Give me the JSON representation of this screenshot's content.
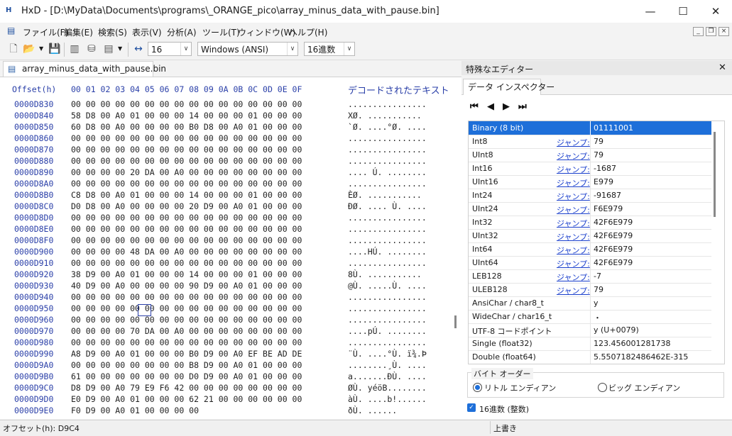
{
  "window": {
    "title": "HxD - [D:\\MyData\\Documents\\programs\\_ORANGE_pico\\array_minus_data_with_pause.bin]",
    "minimize": "—",
    "maximize": "☐",
    "close": "✕"
  },
  "menu": [
    "ファイル(F)",
    "編集(E)",
    "検索(S)",
    "表示(V)",
    "分析(A)",
    "ツール(T)",
    "ウィンドウ(W)",
    "ヘルプ(H)"
  ],
  "toolbar": {
    "bytes_per_row": "16",
    "charset": "Windows (ANSI)",
    "offset_base": "16進数"
  },
  "document_tab": "array_minus_data_with_pause.bin",
  "hex": {
    "offset_header": "Offset(h)",
    "column_header": "00 01 02 03 04 05 06 07 08 09 0A 0B 0C 0D 0E 0F",
    "decoded_header": "デコードされたテキスト",
    "rows": [
      {
        "offset": "0000D830",
        "bytes": "00 00 00 00 00 00 00 00 00 00 00 00 00 00 00 00",
        "text": "................"
      },
      {
        "offset": "0000D840",
        "bytes": "58 D8 00 A0 01 00 00 00 14 00 00 00 01 00 00 00",
        "text": "XØ. ..........."
      },
      {
        "offset": "0000D850",
        "bytes": "60 D8 00 A0 00 00 00 00 B0 D8 00 A0 01 00 00 00",
        "text": "`Ø. ....°Ø. ...."
      },
      {
        "offset": "0000D860",
        "bytes": "00 00 00 00 00 00 00 00 00 00 00 00 00 00 00 00",
        "text": "................"
      },
      {
        "offset": "0000D870",
        "bytes": "00 00 00 00 00 00 00 00 00 00 00 00 00 00 00 00",
        "text": "................"
      },
      {
        "offset": "0000D880",
        "bytes": "00 00 00 00 00 00 00 00 00 00 00 00 00 00 00 00",
        "text": "................"
      },
      {
        "offset": "0000D890",
        "bytes": "00 00 00 00 20 DA 00 A0 00 00 00 00 00 00 00 00",
        "text": ".... Ú. ........"
      },
      {
        "offset": "0000D8A0",
        "bytes": "00 00 00 00 00 00 00 00 00 00 00 00 00 00 00 00",
        "text": "................"
      },
      {
        "offset": "0000D8B0",
        "bytes": "C8 D8 00 A0 01 00 00 00 14 00 00 00 01 00 00 00",
        "text": "ÈØ. ..........."
      },
      {
        "offset": "0000D8C0",
        "bytes": "D0 D8 00 A0 00 00 00 00 20 D9 00 A0 01 00 00 00",
        "text": "ÐØ. .... Ù. ...."
      },
      {
        "offset": "0000D8D0",
        "bytes": "00 00 00 00 00 00 00 00 00 00 00 00 00 00 00 00",
        "text": "................"
      },
      {
        "offset": "0000D8E0",
        "bytes": "00 00 00 00 00 00 00 00 00 00 00 00 00 00 00 00",
        "text": "................"
      },
      {
        "offset": "0000D8F0",
        "bytes": "00 00 00 00 00 00 00 00 00 00 00 00 00 00 00 00",
        "text": "................"
      },
      {
        "offset": "0000D900",
        "bytes": "00 00 00 00 48 DA 00 A0 00 00 00 00 00 00 00 00",
        "text": "....HÚ. ........"
      },
      {
        "offset": "0000D910",
        "bytes": "00 00 00 00 00 00 00 00 00 00 00 00 00 00 00 00",
        "text": "................"
      },
      {
        "offset": "0000D920",
        "bytes": "38 D9 00 A0 01 00 00 00 14 00 00 00 01 00 00 00",
        "text": "8Ù. ..........."
      },
      {
        "offset": "0000D930",
        "bytes": "40 D9 00 A0 00 00 00 00 90 D9 00 A0 01 00 00 00",
        "text": "@Ù. .....Ù. ...."
      },
      {
        "offset": "0000D940",
        "bytes": "00 00 00 00 00 00 00 00 00 00 00 00 00 00 00 00",
        "text": "................"
      },
      {
        "offset": "0000D950",
        "bytes": "00 00 00 00 00 00 00 00 00 00 00 00 00 00 00 00",
        "text": "................"
      },
      {
        "offset": "0000D960",
        "bytes": "00 00 00 00 00 00 00 00 00 00 00 00 00 00 00 00",
        "text": "................"
      },
      {
        "offset": "0000D970",
        "bytes": "00 00 00 00 70 DA 00 A0 00 00 00 00 00 00 00 00",
        "text": "....pÚ. ........"
      },
      {
        "offset": "0000D980",
        "bytes": "00 00 00 00 00 00 00 00 00 00 00 00 00 00 00 00",
        "text": "................"
      },
      {
        "offset": "0000D990",
        "bytes": "A8 D9 00 A0 01 00 00 00 B0 D9 00 A0 EF BE AD DE",
        "text": "¨Ù. ....°Ù. ï¾.Þ"
      },
      {
        "offset": "0000D9A0",
        "bytes": "00 00 00 00 00 00 00 00 B8 D9 00 A0 01 00 00 00",
        "text": "........¸Ù. ...."
      },
      {
        "offset": "0000D9B0",
        "bytes": "61 00 00 00 00 00 00 00 D0 D9 00 A0 01 00 00 00",
        "text": "a.......ÐÙ. ...."
      },
      {
        "offset": "0000D9C0",
        "bytes": "D8 D9 00 A0 79 E9 F6 42 00 00 00 00 00 00 00 00",
        "text": "ØÙ. yéöB........"
      },
      {
        "offset": "0000D9D0",
        "bytes": "E0 D9 00 A0 01 00 00 00 62 21 00 00 00 00 00 00",
        "text": "àÙ. ....b!......"
      },
      {
        "offset": "0000D9E0",
        "bytes": "F0 D9 00 A0 01 00 00 00 00",
        "text": "ðÙ. ......"
      }
    ]
  },
  "special_editor": {
    "title": "特殊なエディター",
    "close": "✕",
    "tab": "データ インスペクター",
    "nav": [
      "⏮",
      "◀",
      "▶",
      "⏭"
    ],
    "rows": [
      {
        "name": "Binary (8 bit)",
        "jump": "",
        "value": "01111001"
      },
      {
        "name": "Int8",
        "jump": "ジャンプ:",
        "value": "79"
      },
      {
        "name": "UInt8",
        "jump": "ジャンプ:",
        "value": "79"
      },
      {
        "name": "Int16",
        "jump": "ジャンプ:",
        "value": "-1687"
      },
      {
        "name": "UInt16",
        "jump": "ジャンプ:",
        "value": "E979"
      },
      {
        "name": "Int24",
        "jump": "ジャンプ:",
        "value": "-91687"
      },
      {
        "name": "UInt24",
        "jump": "ジャンプ:",
        "value": "F6E979"
      },
      {
        "name": "Int32",
        "jump": "ジャンプ:",
        "value": "42F6E979"
      },
      {
        "name": "UInt32",
        "jump": "ジャンプ:",
        "value": "42F6E979"
      },
      {
        "name": "Int64",
        "jump": "ジャンプ:",
        "value": "42F6E979"
      },
      {
        "name": "UInt64",
        "jump": "ジャンプ:",
        "value": "42F6E979"
      },
      {
        "name": "LEB128",
        "jump": "ジャンプ:",
        "value": "-7"
      },
      {
        "name": "ULEB128",
        "jump": "ジャンプ:",
        "value": "79"
      },
      {
        "name": "AnsiChar / char8_t",
        "jump": "",
        "value": "y"
      },
      {
        "name": "WideChar / char16_t",
        "jump": "",
        "value": "・"
      },
      {
        "name": "UTF-8 コードポイント",
        "jump": "",
        "value": "y (U+0079)"
      },
      {
        "name": "Single (float32)",
        "jump": "",
        "value": "123.456001281738"
      },
      {
        "name": "Double (float64)",
        "jump": "",
        "value": "5.5507182486462E-315"
      }
    ],
    "byte_order_label": "バイト オーダー",
    "little_endian": "リトル エンディアン",
    "big_endian": "ビッグ エンディアン",
    "hex_check_label": "16進数 (整数)"
  },
  "status": {
    "offset": "オフセット(h): D9C4",
    "mode": "上書き"
  }
}
